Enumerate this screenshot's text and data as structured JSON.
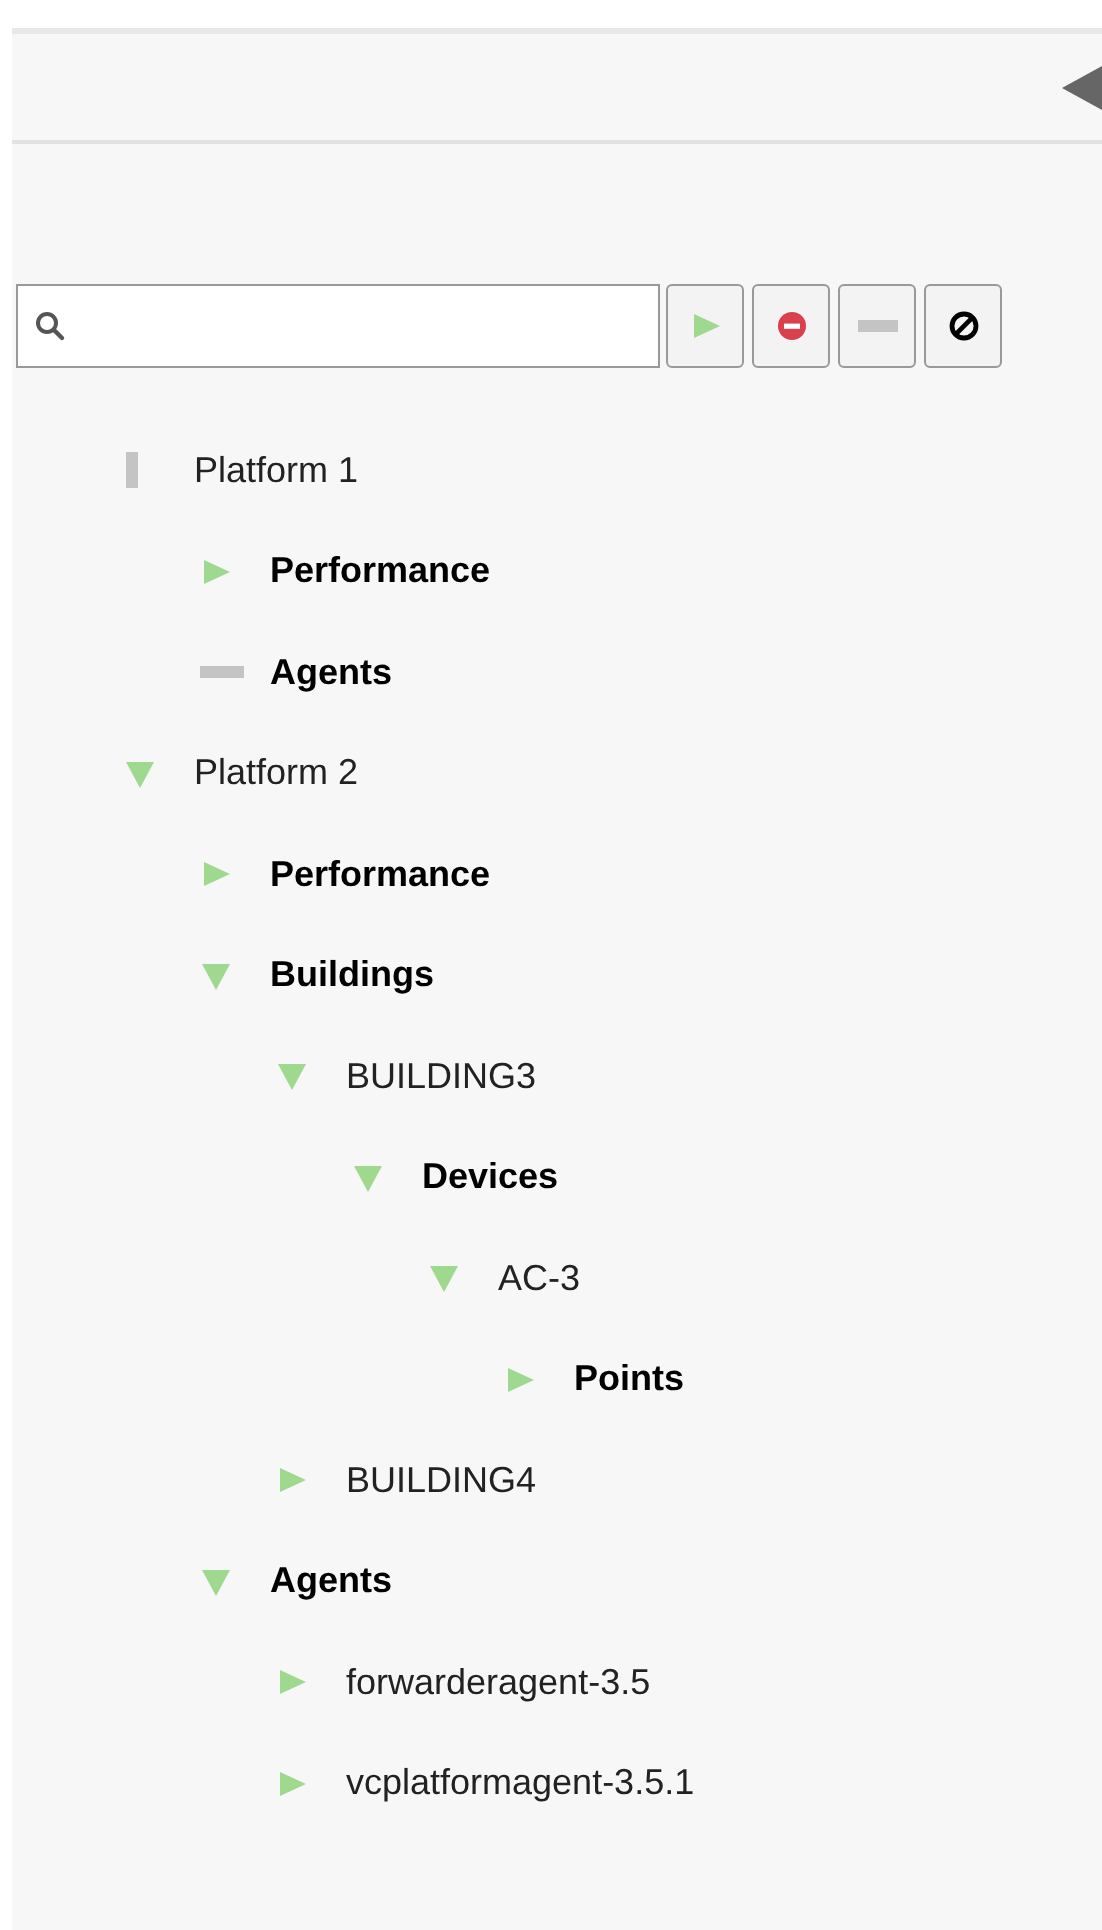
{
  "filter_buttons": [
    {
      "kind": "play"
    },
    {
      "kind": "stop"
    },
    {
      "kind": "dash"
    },
    {
      "kind": "ban"
    }
  ],
  "tree": [
    {
      "label": "Platform 1",
      "bold": false,
      "kind": "vertical-bar",
      "children": [
        {
          "label": "Performance",
          "bold": true,
          "kind": "expander",
          "expanded": false
        },
        {
          "label": "Agents",
          "bold": true,
          "kind": "dash"
        }
      ]
    },
    {
      "label": "Platform 2",
      "bold": false,
      "kind": "expander",
      "expanded": true,
      "children": [
        {
          "label": "Performance",
          "bold": true,
          "kind": "expander",
          "expanded": false
        },
        {
          "label": "Buildings",
          "bold": true,
          "kind": "expander",
          "expanded": true,
          "children": [
            {
              "label": "BUILDING3",
              "bold": false,
              "kind": "expander",
              "expanded": true,
              "children": [
                {
                  "label": "Devices",
                  "bold": true,
                  "kind": "expander",
                  "expanded": true,
                  "children": [
                    {
                      "label": "AC-3",
                      "bold": false,
                      "kind": "expander",
                      "expanded": true,
                      "children": [
                        {
                          "label": "Points",
                          "bold": true,
                          "kind": "expander",
                          "expanded": false
                        }
                      ]
                    }
                  ]
                }
              ]
            },
            {
              "label": "BUILDING4",
              "bold": false,
              "kind": "expander",
              "expanded": false
            }
          ]
        },
        {
          "label": "Agents",
          "bold": true,
          "kind": "expander",
          "expanded": true,
          "children": [
            {
              "label": "forwarderagent-3.5",
              "bold": false,
              "kind": "expander",
              "expanded": false
            },
            {
              "label": "vcplatformagent-3.5.1",
              "bold": false,
              "kind": "expander",
              "expanded": false
            }
          ]
        }
      ]
    }
  ]
}
